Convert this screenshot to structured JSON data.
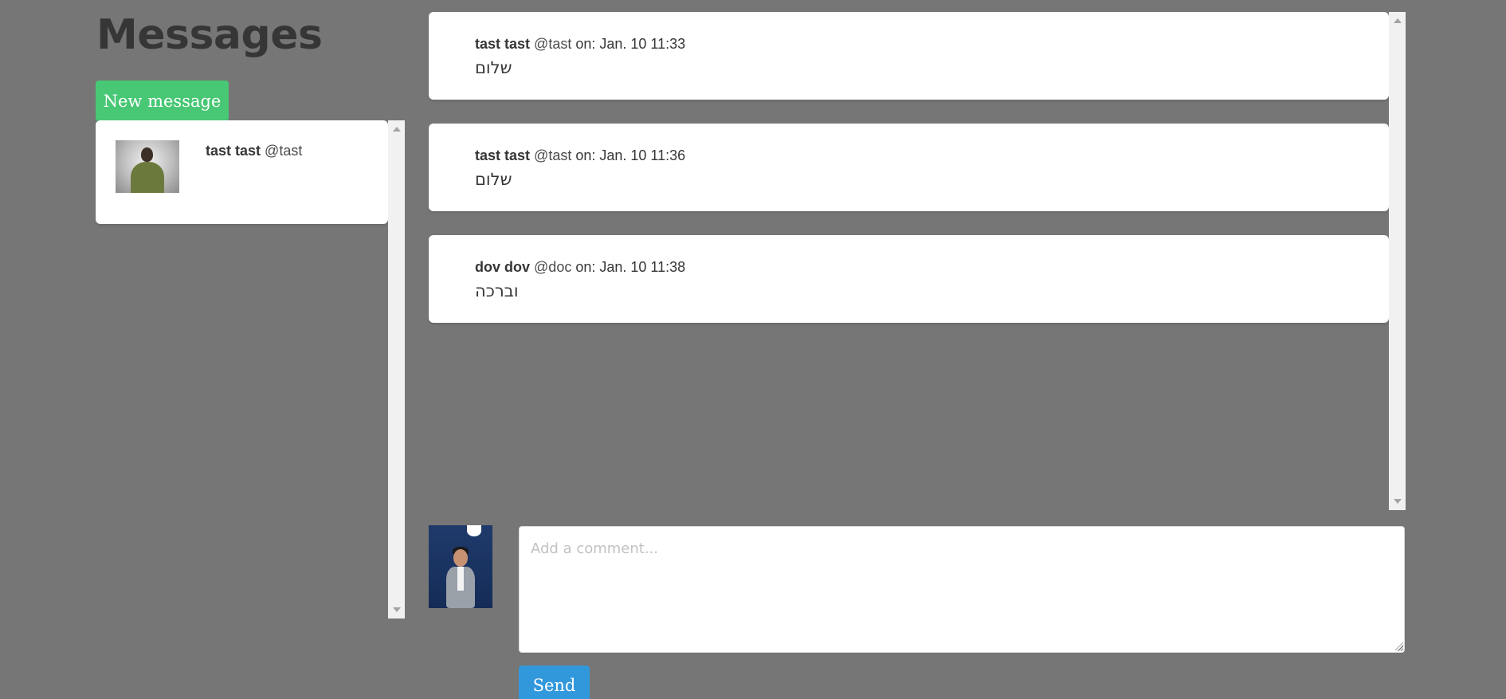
{
  "page": {
    "title": "Messages"
  },
  "toolbar": {
    "new_message_label": "New message"
  },
  "conversations": [
    {
      "name": "tast tast",
      "handle": "@tast",
      "avatar": "user-avatar-icon"
    }
  ],
  "messages": [
    {
      "name": "tast tast",
      "handle": "@tast",
      "meta": "on: Jan. 10 11:33",
      "body": "שלום"
    },
    {
      "name": "tast tast",
      "handle": "@tast",
      "meta": "on: Jan. 10 11:36",
      "body": "שלום"
    },
    {
      "name": "dov dov",
      "handle": "@doc",
      "meta": "on: Jan. 10 11:38",
      "body": "וברכה"
    }
  ],
  "composer": {
    "placeholder": "Add a comment...",
    "value": "",
    "send_label": "Send"
  },
  "colors": {
    "background": "#767676",
    "new_message_button": "#48c774",
    "send_button": "#3298dc",
    "card": "#ffffff"
  }
}
